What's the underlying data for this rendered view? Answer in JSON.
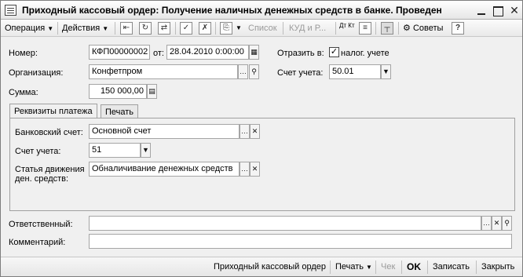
{
  "window": {
    "title": "Приходный кассовый ордер: Получение наличных денежных средств в банке. Проведен",
    "minimize_icon": "minimize-icon",
    "maximize_icon": "maximize-icon",
    "close_icon": "close-icon"
  },
  "toolbar": {
    "operation_label": "Операция",
    "actions_label": "Действия",
    "list_label": "Список",
    "kudir_label": "КУД и Р...",
    "dtkt_label": "Дт Кт",
    "advice_label": "Советы",
    "help_label": "?"
  },
  "form": {
    "number_label": "Номер:",
    "number_value": "КФП00000002",
    "date_label": "от:",
    "date_value": "28.04.2010  0:00:00",
    "reflect_label": "Отразить в:",
    "tax_label": "налог. учете",
    "tax_checked": true,
    "org_label": "Организация:",
    "org_value": "Конфетпром",
    "account_label": "Счет учета:",
    "account_value": "50.01",
    "sum_label": "Сумма:",
    "sum_value": "150 000,00"
  },
  "tabs": [
    {
      "label": "Реквизиты платежа",
      "active": true
    },
    {
      "label": "Печать",
      "active": false
    }
  ],
  "payment": {
    "bank_account_label": "Банковский счет:",
    "bank_account_value": "Основной счет",
    "account_label": "Счет учета:",
    "account_value": "51",
    "cashflow_label_1": "Статья движения",
    "cashflow_label_2": "ден. средств:",
    "cashflow_value": "Обналичивание денежных средств"
  },
  "responsible": {
    "label": "Ответственный:",
    "value": ""
  },
  "comment": {
    "label": "Комментарий:",
    "value": ""
  },
  "bottom": {
    "print_form_label": "Приходный кассовый ордер",
    "print_label": "Печать",
    "check_label": "Чек",
    "ok_label": "OK",
    "save_label": "Записать",
    "close_label": "Закрыть"
  }
}
